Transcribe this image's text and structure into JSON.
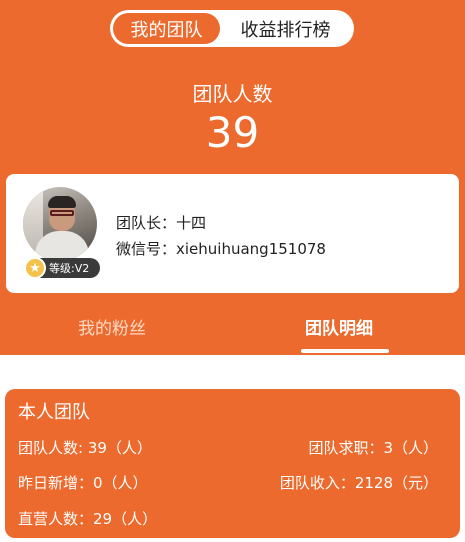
{
  "segment": {
    "my_team": "我的团队",
    "income_rank": "收益排行榜"
  },
  "team": {
    "count_label": "团队人数",
    "count": "39"
  },
  "leader": {
    "level": "等级:V2",
    "leader_label": "团队长：十四",
    "wechat_label": "微信号：xiehuihuang151078"
  },
  "tabs": {
    "fans": "我的粉丝",
    "detail": "团队明细"
  },
  "summary": {
    "title": "本人团队",
    "team_count": "团队人数: 39（人）",
    "team_jobs": "团队求职：3（人）",
    "new_yesterday": "昨日新增：0（人）",
    "team_income": "团队收入：2128（元）",
    "direct_count": "直营人数：29（人）"
  },
  "colors": {
    "accent": "#ec6a2d",
    "badge": "#f2c24b"
  }
}
